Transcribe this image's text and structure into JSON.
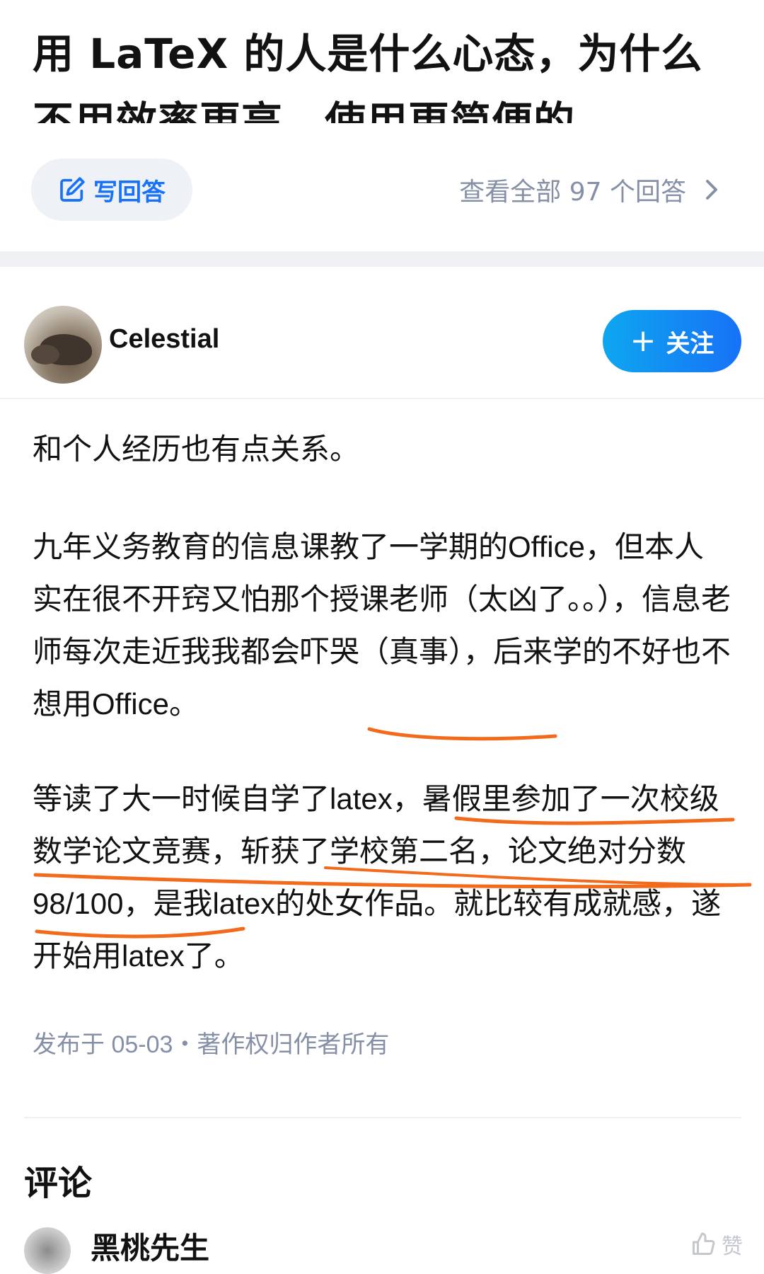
{
  "question": {
    "title": "用 LaTeX 的人是什么心态，为什么不用效率更高、使用更简便的 Office?"
  },
  "actions": {
    "write_answer_label": "写回答",
    "view_all_label": "查看全部 97 个回答"
  },
  "author": {
    "name": "Celestial",
    "follow_label": "关注"
  },
  "answer": {
    "paragraphs": [
      "和个人经历也有点关系。",
      "九年义务教育的信息课教了一学期的Office，但本人实在很不开窍又怕那个授课老师（太凶了。。），信息老师每次走近我我都会吓哭（真事），后来学的不好也不想用Office。",
      "等读了大一时候自学了latex，暑假里参加了一次校级数学论文竞赛，斩获了学校第二名，论文绝对分数98/100，是我latex的处女作品。就比较有成就感，遂开始用latex了。"
    ],
    "meta": "发布于 05-03・著作权归作者所有"
  },
  "comments": {
    "heading": "评论",
    "first_commenter": "黑桃先生",
    "like_label": "赞"
  },
  "colors": {
    "accent": "#1772f6",
    "muted": "#8590a6",
    "annotation": "#f26a1b"
  },
  "icons": {
    "write": "edit-square-icon",
    "chevron": "chevron-right-icon",
    "plus": "plus-icon",
    "like": "thumbs-up-icon"
  }
}
